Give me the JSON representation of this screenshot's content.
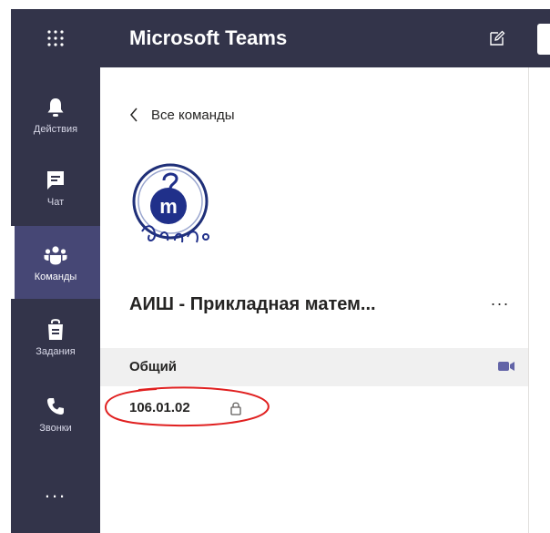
{
  "header": {
    "title": "Microsoft Teams"
  },
  "rail": {
    "items": [
      {
        "label": "Действия",
        "icon": "bell-icon",
        "active": false
      },
      {
        "label": "Чат",
        "icon": "chat-icon",
        "active": false
      },
      {
        "label": "Команды",
        "icon": "teams-icon",
        "active": true
      },
      {
        "label": "Задания",
        "icon": "assignments-icon",
        "active": false
      },
      {
        "label": "Звонки",
        "icon": "phone-icon",
        "active": false
      }
    ],
    "more": "..."
  },
  "pane": {
    "back_label": "Все команды",
    "team_name": "АИШ - Прикладная матем...",
    "team_more": "···",
    "channels": [
      {
        "label": "Общий",
        "icon": "meet-now-icon"
      },
      {
        "label": "106.01.02",
        "icon": "lock-icon",
        "private": true
      }
    ]
  },
  "colors": {
    "rail_bg": "#33344a",
    "rail_active_bg": "#464775",
    "channel_selected_bg": "#f0f0f0",
    "accent": "#6264a7",
    "annotation": "#e02020"
  }
}
